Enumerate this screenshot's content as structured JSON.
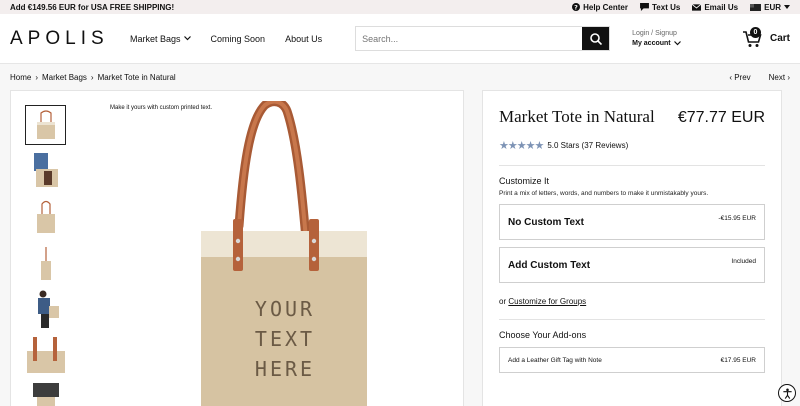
{
  "topbar": {
    "promo": "Add €149.56 EUR for USA FREE SHIPPING!",
    "help": "Help Center",
    "text": "Text Us",
    "email": "Email Us",
    "currency": "EUR"
  },
  "header": {
    "logo": "APOLIS",
    "nav": [
      "Market Bags",
      "Coming Soon",
      "About Us"
    ],
    "search_placeholder": "Search...",
    "login": "Login / Signup",
    "account": "My account",
    "cart_label": "Cart",
    "cart_count": "0"
  },
  "breadcrumb": {
    "items": [
      "Home",
      "Market Bags",
      "Market Tote in Natural"
    ],
    "sep": "›",
    "prev": "Prev",
    "next": "Next"
  },
  "gallery": {
    "note": "Make it yours with custom printed text.",
    "tote_text": [
      "YOUR",
      "TEXT",
      "HERE"
    ]
  },
  "product": {
    "name": "Market Tote in Natural",
    "price": "€77.77 EUR",
    "stars": "★★★★★",
    "rating": "5.0 Stars (37 Reviews)",
    "customize_label": "Customize It",
    "customize_sub": "Print a mix of letters, words, and numbers to make it unmistakably yours.",
    "options": [
      {
        "label": "No Custom Text",
        "price": "-€15.95 EUR"
      },
      {
        "label": "Add Custom Text",
        "price": "Included"
      }
    ],
    "groups_prefix": "or",
    "groups_link": "Customize for Groups",
    "addons_label": "Choose Your Add-ons",
    "addon": {
      "label": "Add a Leather Gift Tag with Note",
      "price": "€17.95 EUR"
    }
  },
  "colors": {
    "accent": "#111111",
    "stars": "#7d93b5",
    "leather": "#b5623b",
    "jute": "#d9c6a7"
  }
}
